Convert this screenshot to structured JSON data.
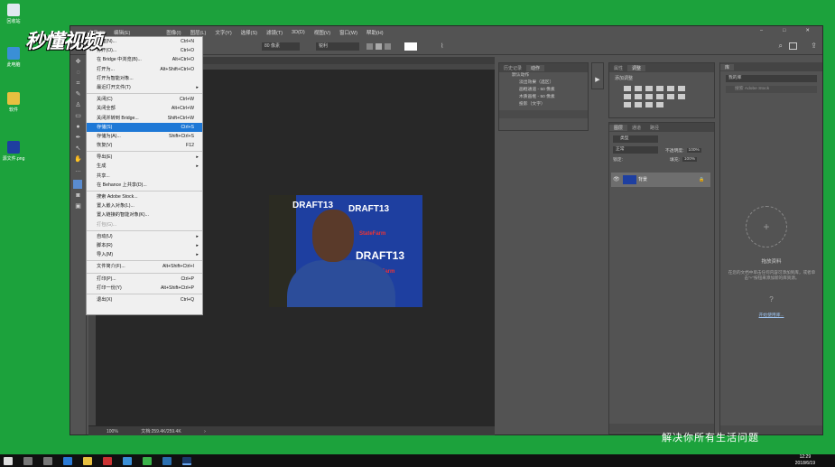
{
  "desktop": {
    "icons": [
      {
        "label": "回收站",
        "icon": "recycle-bin-icon"
      },
      {
        "label": "此电脑",
        "icon": "computer-icon"
      },
      {
        "label": "软件",
        "icon": "folder-icon"
      },
      {
        "label": "源文件.png",
        "icon": "image-file-icon"
      }
    ]
  },
  "watermark": {
    "logo": "秒懂视频",
    "subtitle": "解决你所有生活问题"
  },
  "menubar": {
    "items": [
      "文件(F)",
      "编辑(E)",
      "图像(I)",
      "图层(L)",
      "文字(Y)",
      "选择(S)",
      "滤镜(T)",
      "3D(D)",
      "视图(V)",
      "窗口(W)",
      "帮助(H)"
    ]
  },
  "options_bar": {
    "font_size": "80 像素",
    "antialias": "锐利"
  },
  "file_menu": {
    "items": [
      {
        "label": "新建(N)...",
        "shortcut": "Ctrl+N",
        "type": "item"
      },
      {
        "label": "打开(O)...",
        "shortcut": "Ctrl+O",
        "type": "item"
      },
      {
        "label": "在 Bridge 中浏览(B)...",
        "shortcut": "Alt+Ctrl+O",
        "type": "item"
      },
      {
        "label": "打开为...",
        "shortcut": "Alt+Shift+Ctrl+O",
        "type": "item"
      },
      {
        "label": "打开为智能对象...",
        "shortcut": "",
        "type": "item"
      },
      {
        "label": "最近打开文件(T)",
        "shortcut": "",
        "type": "submenu"
      },
      {
        "type": "sep"
      },
      {
        "label": "关闭(C)",
        "shortcut": "Ctrl+W",
        "type": "item"
      },
      {
        "label": "关闭全部",
        "shortcut": "Alt+Ctrl+W",
        "type": "item"
      },
      {
        "label": "关闭并转到 Bridge...",
        "shortcut": "Shift+Ctrl+W",
        "type": "item"
      },
      {
        "label": "存储(S)",
        "shortcut": "Ctrl+S",
        "type": "highlight"
      },
      {
        "label": "存储为(A)...",
        "shortcut": "Shift+Ctrl+S",
        "type": "item"
      },
      {
        "label": "恢复(V)",
        "shortcut": "F12",
        "type": "item"
      },
      {
        "type": "sep"
      },
      {
        "label": "导出(E)",
        "shortcut": "",
        "type": "submenu"
      },
      {
        "label": "生成",
        "shortcut": "",
        "type": "submenu"
      },
      {
        "label": "共享...",
        "shortcut": "",
        "type": "item"
      },
      {
        "label": "在 Behance 上共享(D)...",
        "shortcut": "",
        "type": "item"
      },
      {
        "type": "sep"
      },
      {
        "label": "搜索 Adobe Stock...",
        "shortcut": "",
        "type": "item"
      },
      {
        "label": "置入嵌入对象(L)...",
        "shortcut": "",
        "type": "item"
      },
      {
        "label": "置入链接的智能对象(K)...",
        "shortcut": "",
        "type": "item"
      },
      {
        "label": "打包(G)...",
        "shortcut": "",
        "type": "disabled"
      },
      {
        "type": "sep"
      },
      {
        "label": "自动(U)",
        "shortcut": "",
        "type": "submenu"
      },
      {
        "label": "脚本(R)",
        "shortcut": "",
        "type": "submenu"
      },
      {
        "label": "导入(M)",
        "shortcut": "",
        "type": "submenu"
      },
      {
        "type": "sep"
      },
      {
        "label": "文件简介(F)...",
        "shortcut": "Alt+Shift+Ctrl+I",
        "type": "item"
      },
      {
        "type": "sep"
      },
      {
        "label": "打印(P)...",
        "shortcut": "Ctrl+P",
        "type": "item"
      },
      {
        "label": "打印一份(Y)",
        "shortcut": "Alt+Shift+Ctrl+P",
        "type": "item"
      },
      {
        "type": "sep"
      },
      {
        "label": "退出(X)",
        "shortcut": "Ctrl+Q",
        "type": "item"
      }
    ]
  },
  "document": {
    "zoom": "100%",
    "doc_info": "文档:259.4K/259.4K",
    "image_text": [
      "DRAFT13",
      "DRAFT13",
      "DRAFT13",
      "StateFarm",
      "StateFarm"
    ]
  },
  "actions_panel": {
    "tabs": [
      "历史记录",
      "动作"
    ],
    "rows": [
      "默认动作",
      "淡出效果（选区）",
      "画框通道 - 50 像素",
      "木质画框 - 50 像素",
      "投影（文字）"
    ]
  },
  "adjust_panel": {
    "tabs": [
      "属性",
      "调整"
    ],
    "title": "添加调整"
  },
  "layers_panel": {
    "tabs": [
      "图层",
      "通道",
      "路径"
    ],
    "kind": "类型",
    "blend": "正常",
    "opacity_label": "不透明度:",
    "opacity": "100%",
    "lock_label": "锁定:",
    "fill_label": "填充:",
    "fill": "100%",
    "layer_name": "背景"
  },
  "library_panel": {
    "tab": "库",
    "library": "我的库",
    "search": "搜索 Adobe Stock",
    "title": "拖放资料",
    "desc": "在您的文档中单击任何内容可添加到库，或者单击\"+\"按钮来添加新的库资源。",
    "link": "开始使用库..."
  },
  "taskbar": {
    "time": "12:29",
    "date": "2018/6/19"
  }
}
